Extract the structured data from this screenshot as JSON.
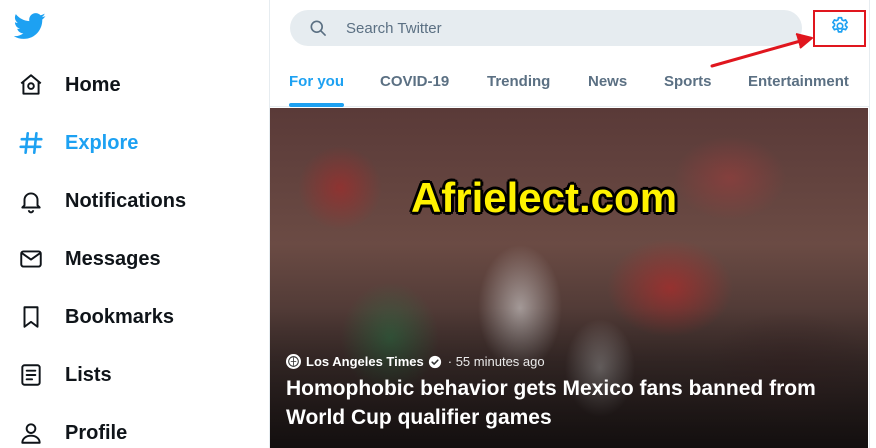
{
  "sidebar": {
    "items": [
      {
        "label": "Home",
        "icon": "home-icon"
      },
      {
        "label": "Explore",
        "icon": "hashtag-icon"
      },
      {
        "label": "Notifications",
        "icon": "bell-icon"
      },
      {
        "label": "Messages",
        "icon": "envelope-icon"
      },
      {
        "label": "Bookmarks",
        "icon": "bookmark-icon"
      },
      {
        "label": "Lists",
        "icon": "list-icon"
      },
      {
        "label": "Profile",
        "icon": "person-icon"
      }
    ],
    "active_index": 1
  },
  "search": {
    "placeholder": "Search Twitter",
    "value": ""
  },
  "tabs": [
    {
      "label": "For you"
    },
    {
      "label": "COVID-19"
    },
    {
      "label": "Trending"
    },
    {
      "label": "News"
    },
    {
      "label": "Sports"
    },
    {
      "label": "Entertainment"
    }
  ],
  "active_tab": 0,
  "hero": {
    "watermark": "Afrielect.com",
    "source": "Los Angeles Times",
    "time": "· 55 minutes ago",
    "headline": "Homophobic behavior gets Mexico fans banned from World Cup qualifier games"
  },
  "colors": {
    "accent": "#1da1f2",
    "annotation": "#e0161e",
    "watermark": "#fff200"
  }
}
